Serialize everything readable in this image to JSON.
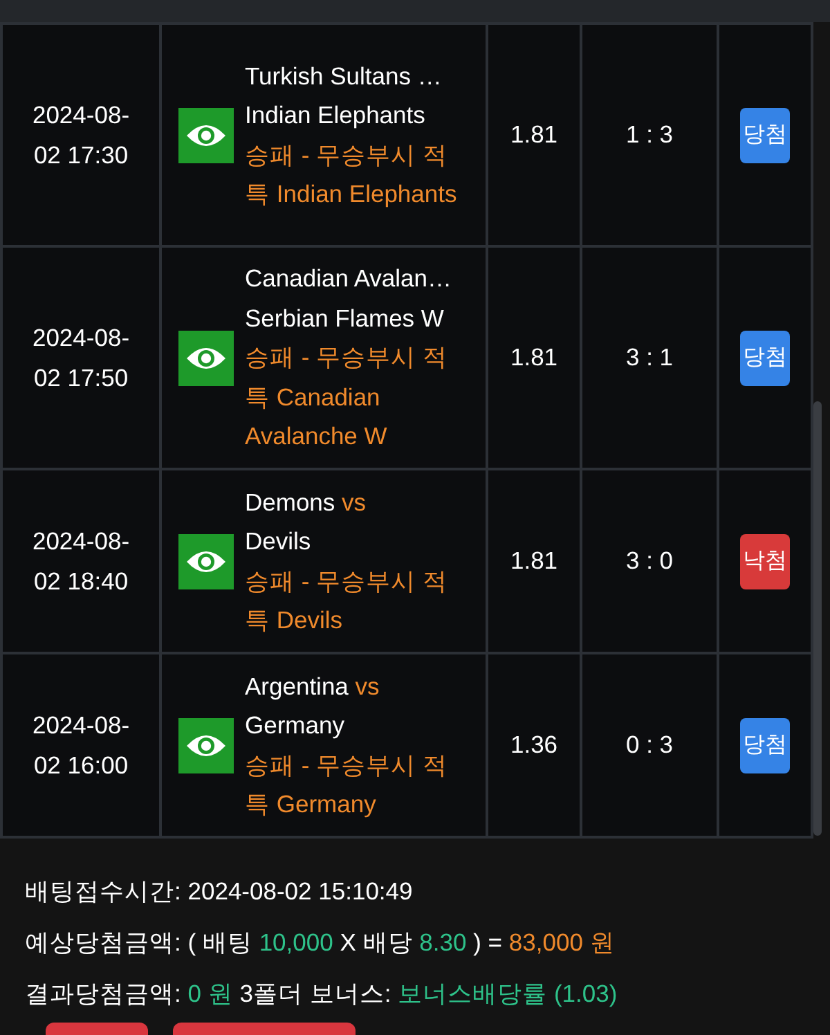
{
  "bets": [
    {
      "time": "2024-08-02 17:30",
      "home": "Turkish Sultans …",
      "away": "Indian Elephants",
      "market": "승패 - 무승부시 적특 Indian Elephants",
      "odds": "1.81",
      "score": "1 : 3",
      "result": {
        "text": "당첨",
        "kind": "win"
      }
    },
    {
      "time": "2024-08-02 17:50",
      "home": "Canadian Avalan…",
      "away": "Serbian Flames W",
      "market": "승패 - 무승부시 적특 Canadian Avalanche W",
      "odds": "1.81",
      "score": "3 : 1",
      "result": {
        "text": "당첨",
        "kind": "win"
      }
    },
    {
      "time": "2024-08-02 18:40",
      "home": "Demons",
      "vs": "vs",
      "away": "Devils",
      "market": "승패 - 무승부시 적특 Devils",
      "odds": "1.81",
      "score": "3 : 0",
      "result": {
        "text": "낙첨",
        "kind": "lose"
      }
    },
    {
      "time": "2024-08-02 16:00",
      "home": "Argentina",
      "vs": "vs",
      "away": "Germany",
      "market": "승패 - 무승부시 적특 Germany",
      "odds": "1.36",
      "score": "0 : 3",
      "result": {
        "text": "당첨",
        "kind": "win"
      }
    }
  ],
  "summary": {
    "bet_time_label": "배팅접수시간:",
    "bet_time": "2024-08-02 15:10:49",
    "expected_label": "예상당첨금액:",
    "open_paren": "(",
    "stake_label": "배팅",
    "stake": "10,000",
    "times": "X",
    "odds_label": "배당",
    "total_odds": "8.30",
    "close_paren": ") =",
    "expected_amount": "83,000 원",
    "result_label": "결과당첨금액:",
    "result_amount": "0 원",
    "bonus_label": "3폴더 보너스:",
    "bonus": "보너스배당률 (1.03)"
  },
  "buttons": [
    {
      "kind": "danger"
    },
    {
      "kind": "danger"
    }
  ]
}
